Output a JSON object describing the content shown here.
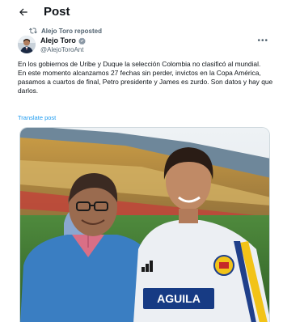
{
  "header": {
    "title": "Post"
  },
  "repost": {
    "label": "Alejo Toro reposted"
  },
  "author": {
    "name": "Alejo Toro",
    "handle": "@AlejoToroAnt"
  },
  "tweet": {
    "paragraph1": "En los gobiernos de Uribe y Duque la selección Colombia no clasificó al mundial.",
    "paragraph2": "En este momento alcanzamos 27 fechas sin perder, invictos en la Copa América, pasamos a cuartos de final, Petro presidente y James es zurdo. Son datos y hay que darlos.",
    "translate_label": "Translate post"
  },
  "photo": {
    "shirt_text": "AGUILA",
    "brand": "adidas"
  },
  "colors": {
    "link": "#1d9bf0",
    "muted": "#536471",
    "text": "#0f1419"
  },
  "icons": {
    "back": "arrow-left-icon",
    "repost": "repost-icon",
    "verified": "verified-badge-icon",
    "more": "more-dots-icon"
  }
}
